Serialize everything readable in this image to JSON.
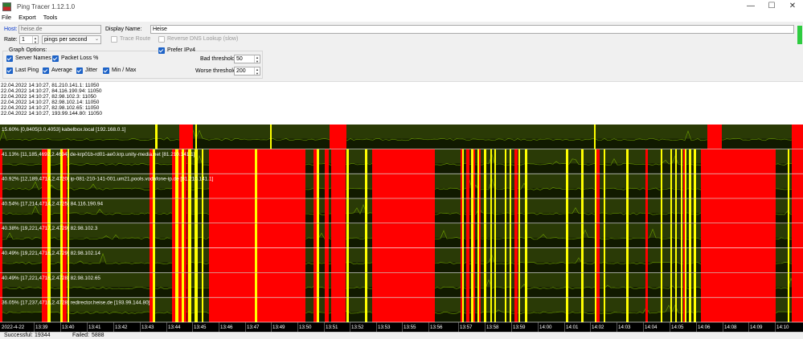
{
  "window": {
    "title": "Ping Tracer 1.12.1.0",
    "minimize": "—",
    "maximize": "☐",
    "close": "✕"
  },
  "menu": [
    "File",
    "Export",
    "Tools"
  ],
  "host": {
    "label": "Host:",
    "value": "heise.de"
  },
  "display_name": {
    "label": "Display Name:",
    "value": "Heise"
  },
  "rate": {
    "label": "Rate:",
    "value": "1",
    "unit": "pings per second"
  },
  "trace_route": {
    "label": "Trace Route",
    "checked": false
  },
  "reverse_dns": {
    "label": "Reverse DNS Lookup (slow)",
    "checked": false
  },
  "graph_options": {
    "title": "Graph Options:",
    "server_names": {
      "label": "Server Names",
      "checked": true
    },
    "packet_loss": {
      "label": "Packet Loss %",
      "checked": true
    },
    "last_ping": {
      "label": "Last Ping",
      "checked": true
    },
    "average": {
      "label": "Average",
      "checked": true
    },
    "jitter": {
      "label": "Jitter",
      "checked": true
    },
    "min_max": {
      "label": "Min / Max",
      "checked": true
    }
  },
  "prefer_ipv4": {
    "label": "Prefer IPv4",
    "checked": true
  },
  "bad_threshold": {
    "label": "Bad threshold:",
    "value": "50"
  },
  "worse_threshold": {
    "label": "Worse threshold:",
    "value": "200"
  },
  "log_lines": [
    "22.04.2022 14:10:27, 81.210.141.1: 11050",
    "22.04.2022 14:10:27, 84.116.190.94: 11050",
    "22.04.2022 14:10:27, 82.98.102.3: 11050",
    "22.04.2022 14:10:27, 82.98.102.14: 11050",
    "22.04.2022 14:10:27, 82.98.102.65: 11050",
    "22.04.2022 14:10:27, 193.99.144.80: 11050"
  ],
  "graph_rows": [
    {
      "label": "15.60% [0,8405|3.0,4053] kabelbox.local [192.168.0.1]",
      "loss_pct": 15.6
    },
    {
      "label": "41.13% [11,185,4692,2.4694] de-krp01b-rd01-ae0.krp.unity-media.net [81.210.141.1]",
      "loss_pct": 41.13
    },
    {
      "label": "40.92% [12,189,4714,2.4720] ip-081-210-141-001.um21.pools.vodafone-ip.de [81.210.141.1]",
      "loss_pct": 40.92
    },
    {
      "label": "40.54% [17,214,4714,2.4725] 84.116.190.94",
      "loss_pct": 40.54
    },
    {
      "label": "40.38% [19,221,4717,2.4729] 82.98.102.3",
      "loss_pct": 40.38
    },
    {
      "label": "40.49% [19,221,4716,2.4729] 82.98.102.14",
      "loss_pct": 40.49
    },
    {
      "label": "40.49% [17,221,4716,2.4728] 82.98.102.65",
      "loss_pct": 40.49
    },
    {
      "label": "36.05% [17,237,4716,2.4728] redirector.heise.de [193.99.144.80]",
      "loss_pct": 36.05
    }
  ],
  "timeline_labels": [
    "2022-4-22",
    "13:39",
    "13:40",
    "13:41",
    "13:42",
    "13:43",
    "13:44",
    "13:45",
    "13:46",
    "13:47",
    "13:49",
    "13:50",
    "13:51",
    "13:52",
    "13:53",
    "13:55",
    "13:56",
    "13:57",
    "13:58",
    "13:59",
    "14:00",
    "14:01",
    "14:02",
    "14:03",
    "14:04",
    "14:05",
    "14:06",
    "14:08",
    "14:09",
    "14:10"
  ],
  "status": {
    "successful_label": "Successful:",
    "successful": "19344",
    "failed_label": "Failed:",
    "failed": "5888"
  },
  "colors": {
    "fail": "#ff0000",
    "bad": "#ffff00",
    "ok_band": "#2a3a06",
    "dark_band": "#111a00",
    "line": "#6ea000",
    "separator": "#ffffff",
    "status_ok": "#2ecc40"
  }
}
